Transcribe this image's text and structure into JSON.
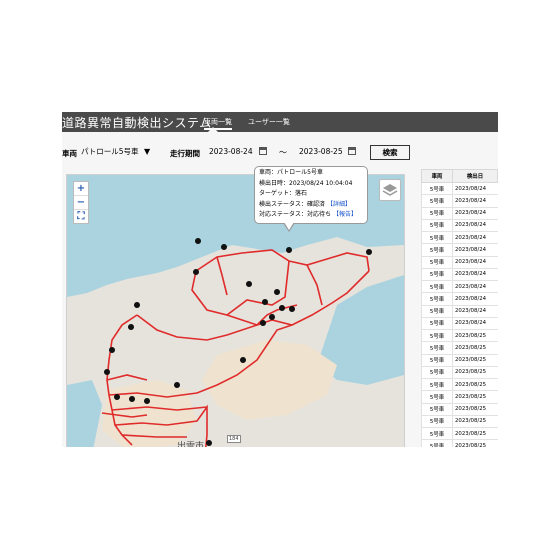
{
  "app": {
    "title": "道路異常自動検出システム",
    "nav": [
      {
        "label": "車両一覧",
        "active": true
      },
      {
        "label": "ユーザー一覧",
        "active": false
      }
    ]
  },
  "filters": {
    "vehicle_label": "車両",
    "vehicle_value": "パトロール5号車",
    "period_label": "走行期間",
    "date_from": "2023-08-24",
    "date_to": "2023-08-25",
    "range_separator": "～",
    "search_label": "検索"
  },
  "map": {
    "zoom_in": "+",
    "zoom_out": "−",
    "fullscreen": "⛶",
    "city_label": "出雲市",
    "road_number": "184",
    "route_color": "#e02b2b",
    "popup": {
      "vehicle": "車両：パトロール5号車",
      "detected_at": "検出日時：2023/08/24 10:04:04",
      "target": "ターゲット：落石",
      "detect_status_prefix": "検出ステータス：確認済",
      "detect_status_link": "【詳細】",
      "response_status_prefix": "対応ステータス：対応待ち",
      "response_status_link": "【報告】"
    }
  },
  "table": {
    "headers": [
      "車両",
      "検出日"
    ],
    "rows": [
      [
        "5号車",
        "2023/08/24"
      ],
      [
        "5号車",
        "2023/08/24"
      ],
      [
        "5号車",
        "2023/08/24"
      ],
      [
        "5号車",
        "2023/08/24"
      ],
      [
        "5号車",
        "2023/08/24"
      ],
      [
        "5号車",
        "2023/08/24"
      ],
      [
        "5号車",
        "2023/08/24"
      ],
      [
        "5号車",
        "2023/08/24"
      ],
      [
        "5号車",
        "2023/08/24"
      ],
      [
        "5号車",
        "2023/08/24"
      ],
      [
        "5号車",
        "2023/08/24"
      ],
      [
        "5号車",
        "2023/08/24"
      ],
      [
        "5号車",
        "2023/08/25"
      ],
      [
        "5号車",
        "2023/08/25"
      ],
      [
        "5号車",
        "2023/08/25"
      ],
      [
        "5号車",
        "2023/08/25"
      ],
      [
        "5号車",
        "2023/08/25"
      ],
      [
        "5号車",
        "2023/08/25"
      ],
      [
        "5号車",
        "2023/08/25"
      ],
      [
        "5号車",
        "2023/08/25"
      ],
      [
        "5号車",
        "2023/08/25"
      ],
      [
        "5号車",
        "2023/08/25"
      ],
      [
        "5号車",
        "2023/08/25"
      ],
      [
        "5号車",
        "2023/08/25"
      ]
    ]
  }
}
